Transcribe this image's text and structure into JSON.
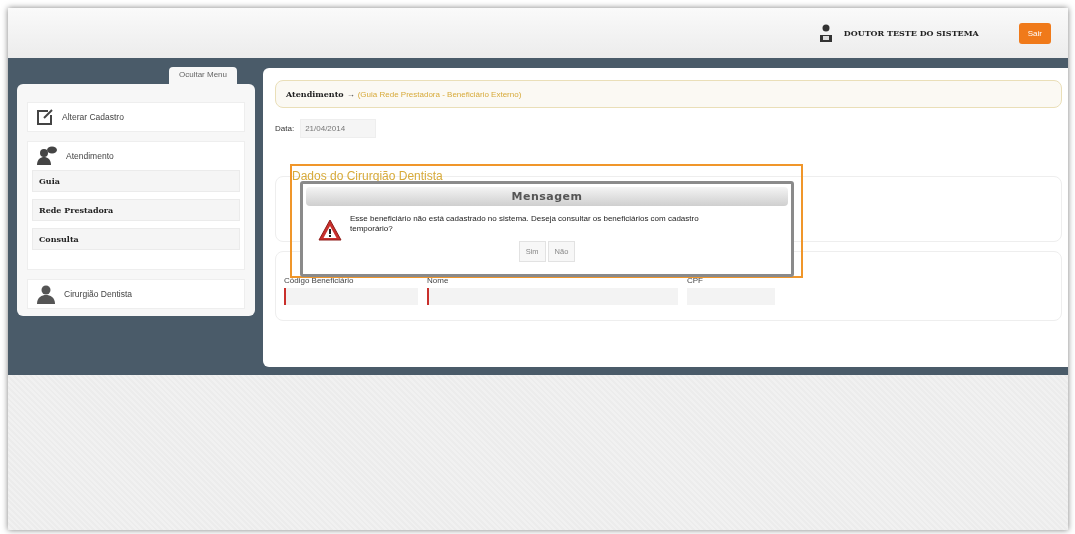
{
  "header": {
    "user_name": "DOUTOR TESTE DO SISTEMA",
    "logout": "Sair"
  },
  "sidebar": {
    "toggle": "Ocultar Menu",
    "items": [
      {
        "kind": "link",
        "label": "Alterar Cadastro"
      },
      {
        "kind": "group",
        "label": "Atendimento",
        "children": [
          {
            "label": "Guia"
          },
          {
            "label": "Rede Prestadora"
          },
          {
            "label": "Consulta"
          }
        ]
      },
      {
        "kind": "link",
        "label": "Cirurgião Dentista"
      }
    ]
  },
  "main": {
    "breadcrumb": {
      "section": "Atendimento",
      "arrow": "→",
      "page": "(Guia Rede Prestadora - Beneficiário Externo)"
    },
    "date": {
      "label": "Data:",
      "value": "21/04/2014"
    },
    "section_title": "Dados do Cirurgião Dentista",
    "fields": [
      {
        "label": "Código Beneficiário",
        "invalid": true
      },
      {
        "label": "Nome",
        "invalid": true
      },
      {
        "label": "CPF",
        "invalid": false
      }
    ]
  },
  "dialog": {
    "title": "Mensagem",
    "message": "Esse beneficiário não está cadastrado no sistema. Deseja consultar os beneficiários com cadastro temporário?",
    "buttons": [
      "Sim",
      "Não"
    ]
  }
}
